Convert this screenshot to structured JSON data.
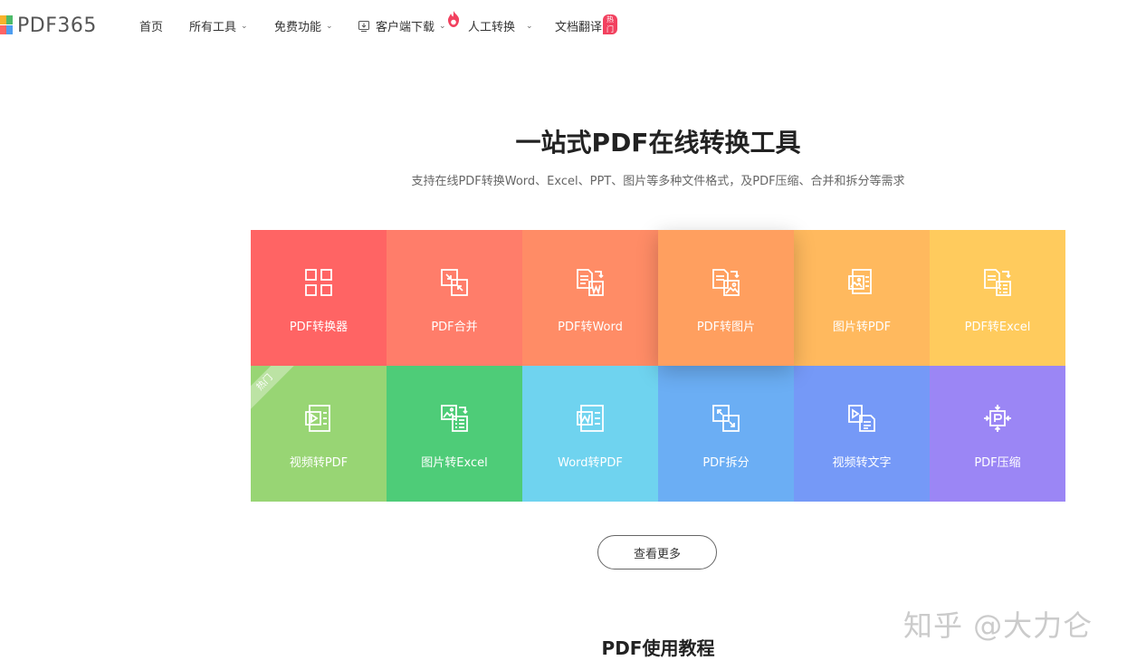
{
  "logo": {
    "text": "PDF365"
  },
  "nav": {
    "home": "首页",
    "all_tools": "所有工具",
    "free_features": "免费功能",
    "client_download": "客户端下载",
    "manual_conversion": "人工转换",
    "doc_translate": "文档翻译",
    "hot_badge": "热门"
  },
  "hero": {
    "title": "一站式PDF在线转换工具",
    "subtitle": "支持在线PDF转换Word、Excel、PPT、图片等多种文件格式，及PDF压缩、合并和拆分等需求"
  },
  "tools": [
    {
      "label": "PDF转换器",
      "icon": "grid-icon",
      "color": "#ff6464"
    },
    {
      "label": "PDF合并",
      "icon": "merge-icon",
      "color": "#ff7d6a"
    },
    {
      "label": "PDF转Word",
      "icon": "word-convert-icon",
      "color": "#ff8c66"
    },
    {
      "label": "PDF转图片",
      "icon": "image-convert-icon",
      "color": "#ff9f5f"
    },
    {
      "label": "图片转PDF",
      "icon": "image-to-pdf-icon",
      "color": "#ffb95e"
    },
    {
      "label": "PDF转Excel",
      "icon": "excel-convert-icon",
      "color": "#ffcb5d"
    },
    {
      "label": "视频转PDF",
      "icon": "video-icon",
      "color": "#98d574",
      "ribbon": "热门"
    },
    {
      "label": "图片转Excel",
      "icon": "image-excel-icon",
      "color": "#4ecc78"
    },
    {
      "label": "Word转PDF",
      "icon": "word-doc-icon",
      "color": "#6fd3ef"
    },
    {
      "label": "PDF拆分",
      "icon": "split-icon",
      "color": "#6baef4"
    },
    {
      "label": "视频转文字",
      "icon": "video-text-icon",
      "color": "#7599f7"
    },
    {
      "label": "PDF压缩",
      "icon": "compress-icon",
      "color": "#9b86f5"
    }
  ],
  "more_button": "查看更多",
  "section": {
    "tutorial_title": "PDF使用教程"
  },
  "watermark": "知乎 @大力仑"
}
